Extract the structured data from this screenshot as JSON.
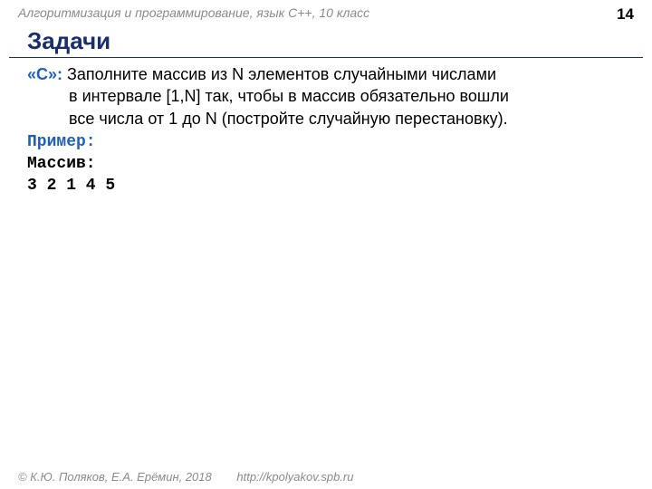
{
  "header": {
    "breadcrumb": "Алгоритмизация и программирование, язык С++, 10 класс",
    "page_number": "14"
  },
  "title": "Задачи",
  "task": {
    "label": "«С»:",
    "line1": " Заполните массив из N элементов случайными числами",
    "line2": "в интервале [1,N] так, чтобы в массив обязательно вошли",
    "line3": "все числа от 1 до N (постройте случайную перестановку)."
  },
  "example": {
    "label": "Пример:",
    "array_label": "Массив:",
    "values": "3 2 1 4 5"
  },
  "footer": {
    "copyright": "© К.Ю. Поляков, Е.А. Ерёмин, 2018",
    "url": "http://kpolyakov.spb.ru"
  }
}
